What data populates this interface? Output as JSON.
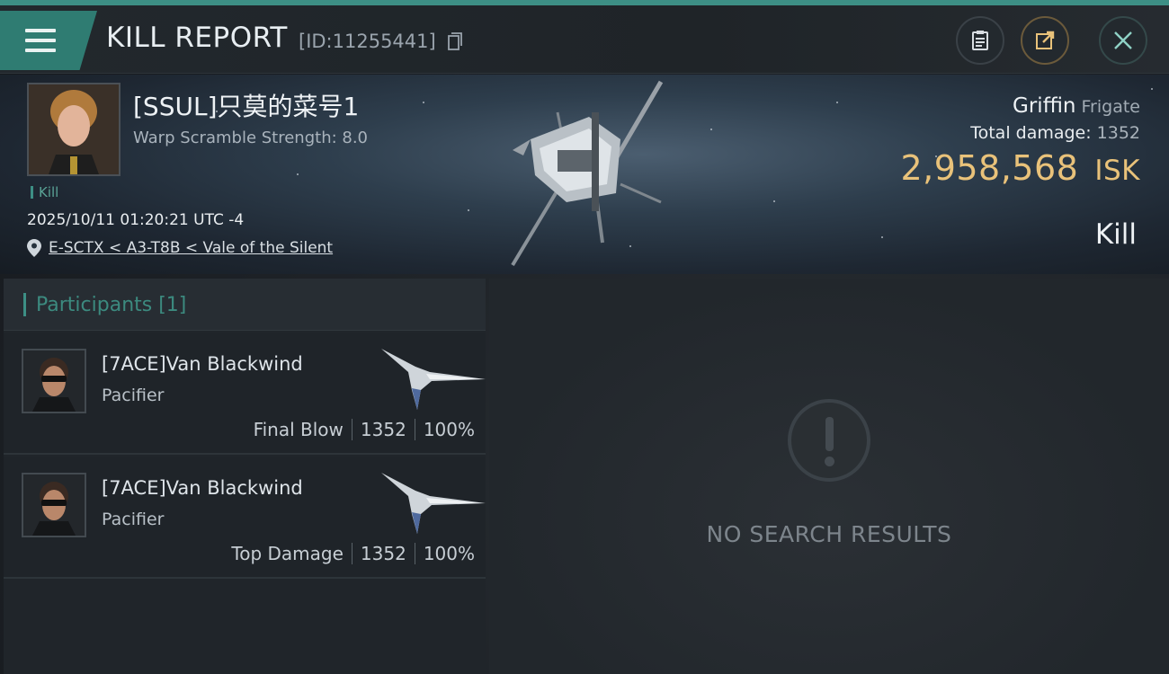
{
  "header": {
    "title": "KILL REPORT",
    "report_id": "[ID:11255441]",
    "icons": [
      "menu-icon",
      "copy-icon",
      "clipboard-icon",
      "share-icon",
      "close-icon"
    ]
  },
  "victim": {
    "name": "[SSUL]只莫的菜号1",
    "subtitle": "Warp Scramble Strength: 8.0",
    "tag": "Kill",
    "timestamp": "2025/10/11 01:20:21 UTC -4",
    "location": "E-SCTX < A3-T8B < Vale of the Silent",
    "ship_name": "Griffin",
    "ship_class": "Frigate",
    "total_damage_label": "Total damage:",
    "total_damage": "1352",
    "isk_value": "2,958,568",
    "isk_unit": "ISK",
    "result": "Kill"
  },
  "participants": {
    "header": "Participants [1]",
    "rows": [
      {
        "name": "[7ACE]Van Blackwind",
        "ship": "Pacifier",
        "role": "Final Blow",
        "damage": "1352",
        "percent": "100%"
      },
      {
        "name": "[7ACE]Van Blackwind",
        "ship": "Pacifier",
        "role": "Top Damage",
        "damage": "1352",
        "percent": "100%"
      }
    ]
  },
  "results_panel": {
    "empty_text": "NO SEARCH RESULTS"
  },
  "colors": {
    "accent": "#3d8f85",
    "isk": "#e9c27a",
    "background": "#1b1f24"
  }
}
